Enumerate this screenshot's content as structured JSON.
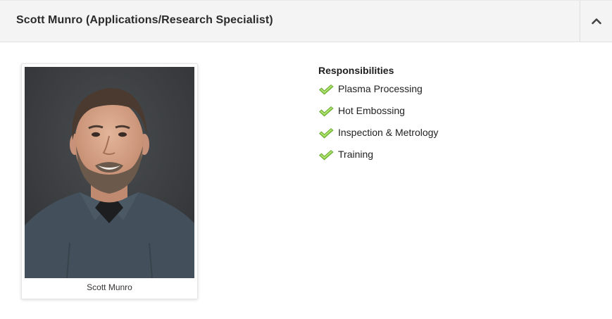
{
  "accordion": {
    "title": "Scott Munro (Applications/Research Specialist)",
    "toggle_icon": "chevron-up-icon"
  },
  "profile": {
    "photo_icon": "person-portrait",
    "caption": "Scott Munro"
  },
  "responsibilities": {
    "heading": "Responsibilities",
    "check_icon": "check-icon",
    "check_color": "#7cc242",
    "items": [
      {
        "label": "Plasma Processing"
      },
      {
        "label": "Hot Embossing"
      },
      {
        "label": "Inspection & Metrology"
      },
      {
        "label": "Training"
      }
    ]
  },
  "colors": {
    "header_bg": "#f4f4f4",
    "text": "#222222"
  }
}
